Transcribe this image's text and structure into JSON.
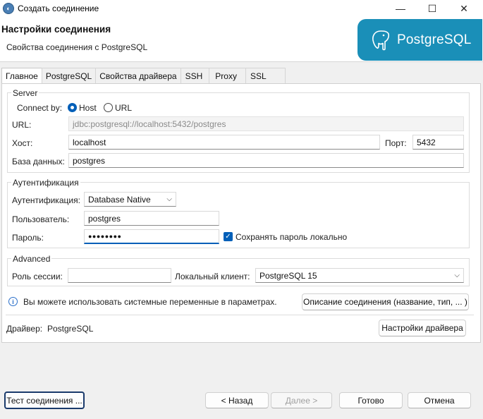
{
  "window": {
    "title": "Создать соединение",
    "minimize": "—",
    "maximize": "☐",
    "close": "✕"
  },
  "header": {
    "title": "Настройки соединения",
    "subtitle": "Свойства соединения с PostgreSQL",
    "logo_text": "PostgreSQL"
  },
  "tabs": [
    "Главное",
    "PostgreSQL",
    "Свойства драйвера",
    "SSH",
    "Proxy",
    "SSL"
  ],
  "server": {
    "legend": "Server",
    "connect_by_label": "Connect by:",
    "host_option": "Host",
    "url_option": "URL",
    "url_label": "URL:",
    "url_value": "jdbc:postgresql://localhost:5432/postgres",
    "host_label": "Хост:",
    "host_value": "localhost",
    "port_label": "Порт:",
    "port_value": "5432",
    "db_label": "База данных:",
    "db_value": "postgres"
  },
  "auth": {
    "legend": "Аутентификация",
    "auth_label": "Аутентификация:",
    "auth_value": "Database Native",
    "user_label": "Пользователь:",
    "user_value": "postgres",
    "password_label": "Пароль:",
    "password_value": "●●●●●●●●",
    "save_password_label": "Сохранять пароль локально"
  },
  "advanced": {
    "legend": "Advanced",
    "role_label": "Роль сессии:",
    "role_value": "",
    "client_label": "Локальный клиент:",
    "client_value": "PostgreSQL 15"
  },
  "info": {
    "text": "Вы можете использовать системные переменные в параметрах.",
    "describe_button": "Описание соединения (название, тип, ... )"
  },
  "driver": {
    "label": "Драйвер:",
    "name": "PostgreSQL",
    "settings_button": "Настройки драйвера"
  },
  "footer": {
    "test_button": "Тест соединения ...",
    "back_button": "< Назад",
    "next_button": "Далее >",
    "finish_button": "Готово",
    "cancel_button": "Отмена"
  }
}
